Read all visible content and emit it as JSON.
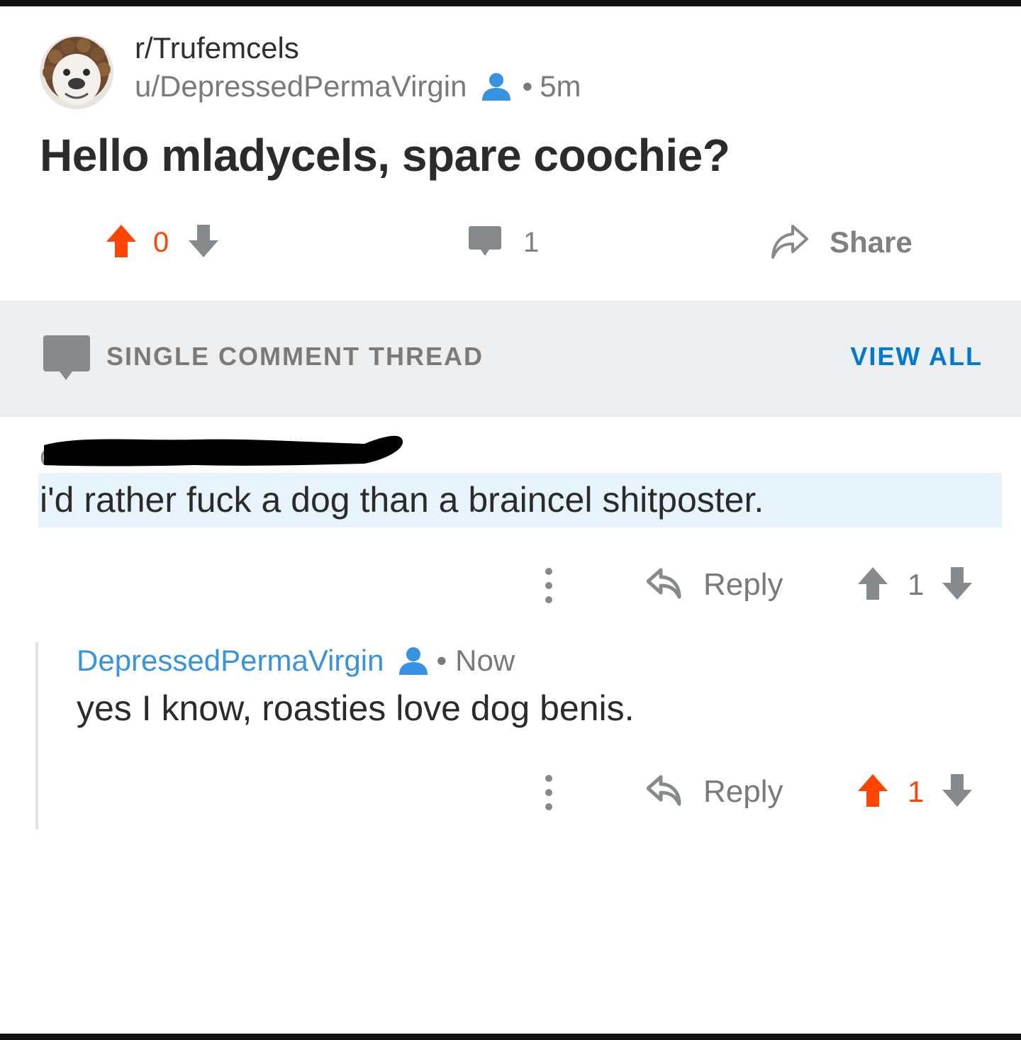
{
  "post": {
    "subreddit": "r/Trufemcels",
    "author": "u/DepressedPermaVirgin",
    "separator": "•",
    "age": "5m",
    "title": "Hello mladycels, spare coochie?",
    "score": "0",
    "comment_count": "1",
    "share_label": "Share",
    "avatar_icon": "bulldog-avatar-icon"
  },
  "thread": {
    "label": "SINGLE COMMENT THREAD",
    "view_all": "VIEW ALL"
  },
  "comments": [
    {
      "author": "",
      "author_redacted": true,
      "body": "i'd rather fuck a dog than a braincel shitposter.",
      "reply_label": "Reply",
      "score": "1",
      "upvoted": false
    },
    {
      "author": "DepressedPermaVirgin",
      "separator": "•",
      "age": "Now",
      "body": "yes I know, roasties love dog benis.",
      "reply_label": "Reply",
      "score": "1",
      "upvoted": true
    }
  ],
  "colors": {
    "upvote_active": "#ff4500",
    "link_blue": "#0079d3",
    "username_blue": "#3793e0",
    "icon_gray": "#878a8c",
    "highlight_bg": "#e8f4fc",
    "thread_bar_bg": "#edeef0"
  }
}
